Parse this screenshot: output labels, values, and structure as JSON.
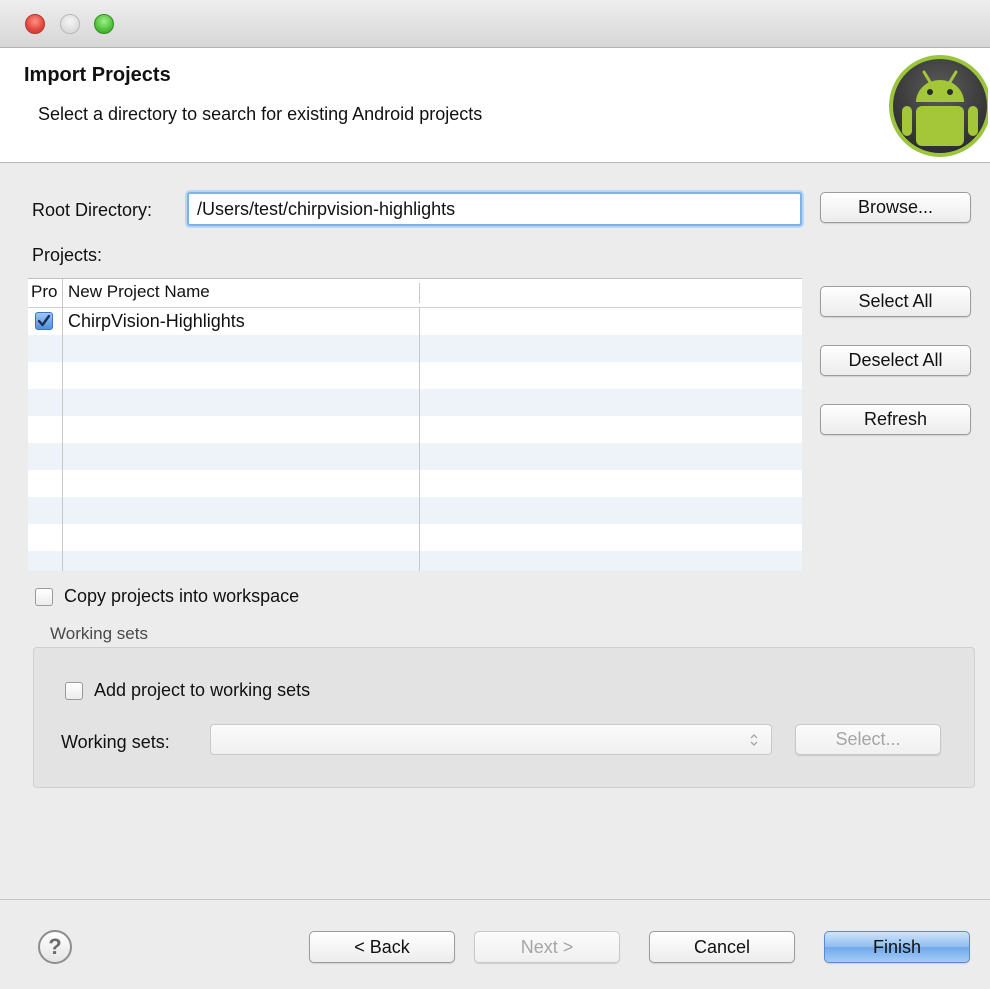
{
  "window": {
    "title": "Import Projects",
    "subtitle": "Select a directory to search for existing Android projects"
  },
  "root_directory": {
    "label": "Root Directory:",
    "value": "/Users/test/chirpvision-highlights",
    "browse_label": "Browse..."
  },
  "projects": {
    "label": "Projects:",
    "columns": [
      "Pro",
      "New Project Name"
    ],
    "rows": [
      {
        "checked": true,
        "name": "ChirpVision-Highlights"
      }
    ],
    "select_all_label": "Select All",
    "deselect_all_label": "Deselect All",
    "refresh_label": "Refresh"
  },
  "copy_into_workspace": {
    "label": "Copy projects into workspace",
    "checked": false
  },
  "working_sets": {
    "group_label": "Working sets",
    "add_label": "Add project to working sets",
    "add_checked": false,
    "sets_label": "Working sets:",
    "sets_value": "",
    "select_label": "Select..."
  },
  "footer": {
    "help_glyph": "?",
    "back_label": "< Back",
    "next_label": "Next >",
    "cancel_label": "Cancel",
    "finish_label": "Finish"
  },
  "colors": {
    "focus_ring": "#7fb0e6",
    "primary_button": "#73a8ec",
    "android_green": "#9bc53d"
  }
}
